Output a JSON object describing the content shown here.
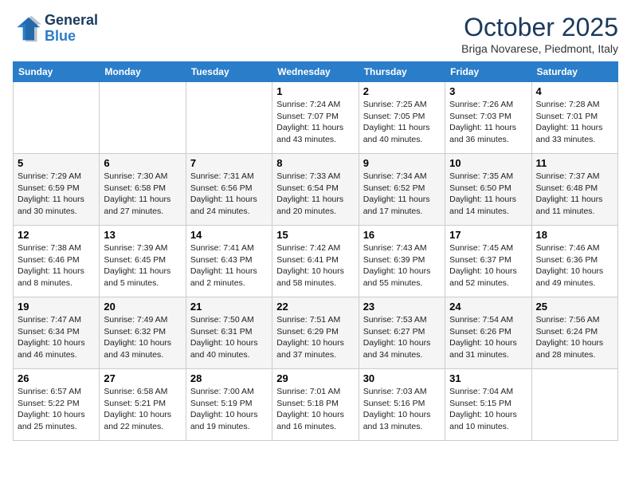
{
  "header": {
    "logo_line1": "General",
    "logo_line2": "Blue",
    "month": "October 2025",
    "location": "Briga Novarese, Piedmont, Italy"
  },
  "weekdays": [
    "Sunday",
    "Monday",
    "Tuesday",
    "Wednesday",
    "Thursday",
    "Friday",
    "Saturday"
  ],
  "weeks": [
    [
      {
        "day": "",
        "info": ""
      },
      {
        "day": "",
        "info": ""
      },
      {
        "day": "",
        "info": ""
      },
      {
        "day": "1",
        "info": "Sunrise: 7:24 AM\nSunset: 7:07 PM\nDaylight: 11 hours\nand 43 minutes."
      },
      {
        "day": "2",
        "info": "Sunrise: 7:25 AM\nSunset: 7:05 PM\nDaylight: 11 hours\nand 40 minutes."
      },
      {
        "day": "3",
        "info": "Sunrise: 7:26 AM\nSunset: 7:03 PM\nDaylight: 11 hours\nand 36 minutes."
      },
      {
        "day": "4",
        "info": "Sunrise: 7:28 AM\nSunset: 7:01 PM\nDaylight: 11 hours\nand 33 minutes."
      }
    ],
    [
      {
        "day": "5",
        "info": "Sunrise: 7:29 AM\nSunset: 6:59 PM\nDaylight: 11 hours\nand 30 minutes."
      },
      {
        "day": "6",
        "info": "Sunrise: 7:30 AM\nSunset: 6:58 PM\nDaylight: 11 hours\nand 27 minutes."
      },
      {
        "day": "7",
        "info": "Sunrise: 7:31 AM\nSunset: 6:56 PM\nDaylight: 11 hours\nand 24 minutes."
      },
      {
        "day": "8",
        "info": "Sunrise: 7:33 AM\nSunset: 6:54 PM\nDaylight: 11 hours\nand 20 minutes."
      },
      {
        "day": "9",
        "info": "Sunrise: 7:34 AM\nSunset: 6:52 PM\nDaylight: 11 hours\nand 17 minutes."
      },
      {
        "day": "10",
        "info": "Sunrise: 7:35 AM\nSunset: 6:50 PM\nDaylight: 11 hours\nand 14 minutes."
      },
      {
        "day": "11",
        "info": "Sunrise: 7:37 AM\nSunset: 6:48 PM\nDaylight: 11 hours\nand 11 minutes."
      }
    ],
    [
      {
        "day": "12",
        "info": "Sunrise: 7:38 AM\nSunset: 6:46 PM\nDaylight: 11 hours\nand 8 minutes."
      },
      {
        "day": "13",
        "info": "Sunrise: 7:39 AM\nSunset: 6:45 PM\nDaylight: 11 hours\nand 5 minutes."
      },
      {
        "day": "14",
        "info": "Sunrise: 7:41 AM\nSunset: 6:43 PM\nDaylight: 11 hours\nand 2 minutes."
      },
      {
        "day": "15",
        "info": "Sunrise: 7:42 AM\nSunset: 6:41 PM\nDaylight: 10 hours\nand 58 minutes."
      },
      {
        "day": "16",
        "info": "Sunrise: 7:43 AM\nSunset: 6:39 PM\nDaylight: 10 hours\nand 55 minutes."
      },
      {
        "day": "17",
        "info": "Sunrise: 7:45 AM\nSunset: 6:37 PM\nDaylight: 10 hours\nand 52 minutes."
      },
      {
        "day": "18",
        "info": "Sunrise: 7:46 AM\nSunset: 6:36 PM\nDaylight: 10 hours\nand 49 minutes."
      }
    ],
    [
      {
        "day": "19",
        "info": "Sunrise: 7:47 AM\nSunset: 6:34 PM\nDaylight: 10 hours\nand 46 minutes."
      },
      {
        "day": "20",
        "info": "Sunrise: 7:49 AM\nSunset: 6:32 PM\nDaylight: 10 hours\nand 43 minutes."
      },
      {
        "day": "21",
        "info": "Sunrise: 7:50 AM\nSunset: 6:31 PM\nDaylight: 10 hours\nand 40 minutes."
      },
      {
        "day": "22",
        "info": "Sunrise: 7:51 AM\nSunset: 6:29 PM\nDaylight: 10 hours\nand 37 minutes."
      },
      {
        "day": "23",
        "info": "Sunrise: 7:53 AM\nSunset: 6:27 PM\nDaylight: 10 hours\nand 34 minutes."
      },
      {
        "day": "24",
        "info": "Sunrise: 7:54 AM\nSunset: 6:26 PM\nDaylight: 10 hours\nand 31 minutes."
      },
      {
        "day": "25",
        "info": "Sunrise: 7:56 AM\nSunset: 6:24 PM\nDaylight: 10 hours\nand 28 minutes."
      }
    ],
    [
      {
        "day": "26",
        "info": "Sunrise: 6:57 AM\nSunset: 5:22 PM\nDaylight: 10 hours\nand 25 minutes."
      },
      {
        "day": "27",
        "info": "Sunrise: 6:58 AM\nSunset: 5:21 PM\nDaylight: 10 hours\nand 22 minutes."
      },
      {
        "day": "28",
        "info": "Sunrise: 7:00 AM\nSunset: 5:19 PM\nDaylight: 10 hours\nand 19 minutes."
      },
      {
        "day": "29",
        "info": "Sunrise: 7:01 AM\nSunset: 5:18 PM\nDaylight: 10 hours\nand 16 minutes."
      },
      {
        "day": "30",
        "info": "Sunrise: 7:03 AM\nSunset: 5:16 PM\nDaylight: 10 hours\nand 13 minutes."
      },
      {
        "day": "31",
        "info": "Sunrise: 7:04 AM\nSunset: 5:15 PM\nDaylight: 10 hours\nand 10 minutes."
      },
      {
        "day": "",
        "info": ""
      }
    ]
  ]
}
